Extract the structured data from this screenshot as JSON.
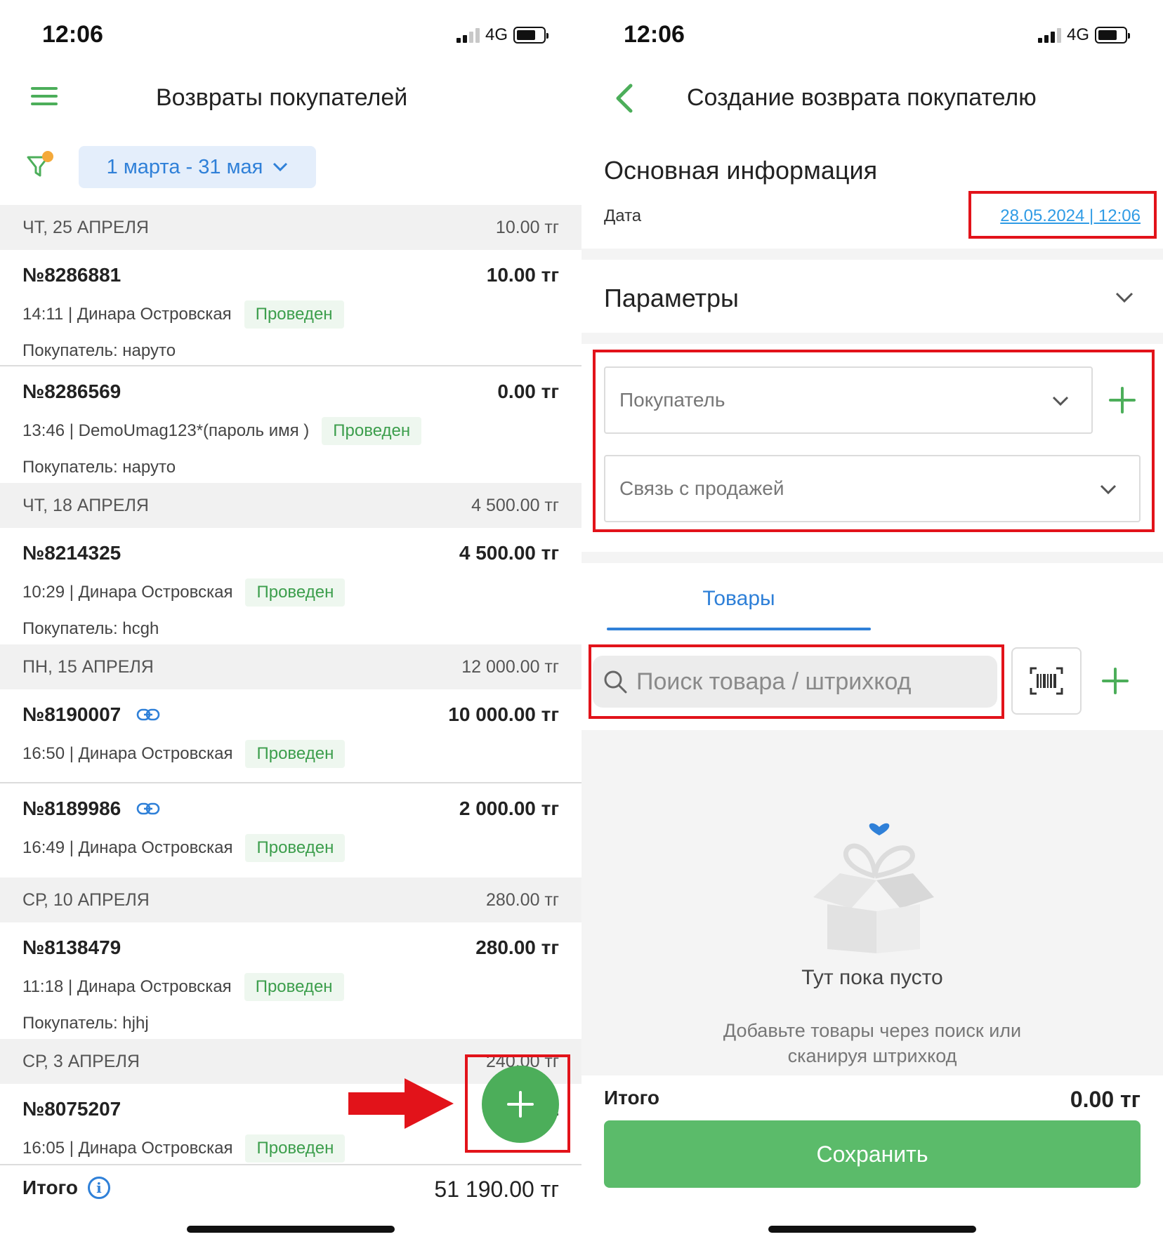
{
  "status_bar": {
    "time": "12:06",
    "network": "4G"
  },
  "left": {
    "title": "Возвраты покупателей",
    "date_range": "1 марта - 31 мая",
    "days": [
      {
        "label": "ЧТ, 25 АПРЕЛЯ",
        "total": "10.00 тг",
        "items": [
          {
            "number": "№8286881",
            "amount": "10.00 тг",
            "meta": "14:11 | Динара Островская",
            "status": "Проведен",
            "buyer": "Покупатель: наруто"
          },
          {
            "number": "№8286569",
            "amount": "0.00 тг",
            "meta": "13:46 | DemoUmag123*(пароль имя )",
            "status": "Проведен",
            "buyer": "Покупатель: наруто"
          }
        ]
      },
      {
        "label": "ЧТ, 18 АПРЕЛЯ",
        "total": "4 500.00 тг",
        "items": [
          {
            "number": "№8214325",
            "amount": "4 500.00 тг",
            "meta": "10:29 | Динара Островская",
            "status": "Проведен",
            "buyer": "Покупатель: hcgh"
          }
        ]
      },
      {
        "label": "ПН, 15 АПРЕЛЯ",
        "total": "12 000.00 тг",
        "items": [
          {
            "number": "№8190007",
            "amount": "10 000.00 тг",
            "meta": "16:50 | Динара Островская",
            "status": "Проведен"
          },
          {
            "number": "№8189986",
            "amount": "2 000.00 тг",
            "meta": "16:49 | Динара Островская",
            "status": "Проведен"
          }
        ]
      },
      {
        "label": "СР, 10 АПРЕЛЯ",
        "total": "280.00 тг",
        "items": [
          {
            "number": "№8138479",
            "amount": "280.00 тг",
            "meta": "11:18 | Динара Островская",
            "status": "Проведен",
            "buyer": "Покупатель: hjhj"
          }
        ]
      },
      {
        "label": "СР, 3 АПРЕЛЯ",
        "total": "240.00 тг",
        "items": [
          {
            "number": "№8075207",
            "amount": "2",
            "meta": "16:05 | Динара Островская",
            "status": "Проведен"
          }
        ]
      }
    ],
    "total_label": "Итого",
    "total_value": "51 190.00 тг"
  },
  "right": {
    "title": "Создание возврата покупателю",
    "main_info_title": "Основная информация",
    "date_label": "Дата",
    "date_value": "28.05.2024 | 12:06",
    "params_title": "Параметры",
    "buyer_select": "Покупатель",
    "sale_link_select": "Связь с продажей",
    "tab_goods": "Товары",
    "search_placeholder": "Поиск товара / штрихкод",
    "empty_title": "Тут пока пусто",
    "empty_text_1": "Добавьте товары через поиск или",
    "empty_text_2": "сканируя штрихкод",
    "total_label": "Итого",
    "total_value": "0.00 тг",
    "save_label": "Сохранить"
  },
  "colors": {
    "accent_green": "#4cae5a",
    "accent_blue": "#2f80d8",
    "annotation_red": "#e2131a"
  },
  "icons": [
    "menu-icon",
    "filter-icon",
    "chevron-down-icon",
    "link-icon",
    "info-icon",
    "plus-icon",
    "back-icon",
    "search-icon",
    "barcode-icon",
    "empty-box-icon"
  ]
}
